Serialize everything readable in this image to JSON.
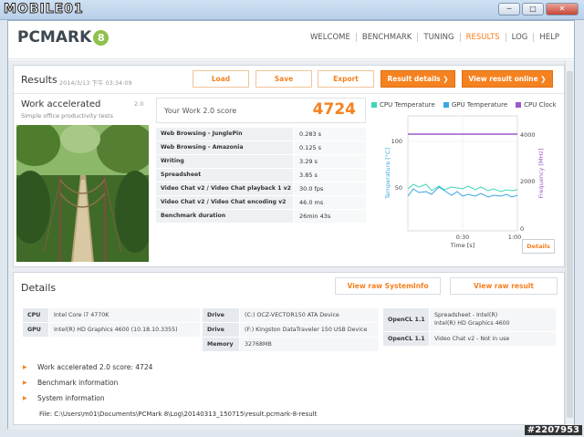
{
  "window": {
    "watermark": "MOBILE01",
    "minimize": "─",
    "maximize": "□",
    "close": "✕"
  },
  "header": {
    "logo_text": "PCMARK",
    "logo_badge": "8",
    "nav": [
      {
        "label": "WELCOME",
        "active": false
      },
      {
        "label": "BENCHMARK",
        "active": false
      },
      {
        "label": "TUNING",
        "active": false
      },
      {
        "label": "RESULTS",
        "active": true
      },
      {
        "label": "LOG",
        "active": false
      },
      {
        "label": "HELP",
        "active": false
      }
    ]
  },
  "results": {
    "title": "Results",
    "date": "2014/3/13 下午 03:34:09",
    "load_label": "Load",
    "save_label": "Save",
    "export_label": "Export",
    "result_details_label": "Result details ❯",
    "view_online_label": "View result online ❯",
    "test_name": "Work accelerated",
    "test_version": "2.0",
    "test_subtitle": "Simple office productivity tests",
    "score_label": "Your Work 2.0 score",
    "score_value": "4724",
    "rows": [
      {
        "k": "Web Browsing - JunglePin",
        "v": "0.283 s"
      },
      {
        "k": "Web Browsing - Amazonia",
        "v": "0.125 s"
      },
      {
        "k": "Writing",
        "v": "3.29 s"
      },
      {
        "k": "Spreadsheet",
        "v": "3.85 s"
      },
      {
        "k": "Video Chat v2 / Video Chat playback 1 v2",
        "v": "30.0 fps"
      },
      {
        "k": "Video Chat v2 / Video Chat encoding v2",
        "v": "46.0 ms"
      },
      {
        "k": "Benchmark duration",
        "v": "26min 43s"
      }
    ]
  },
  "graph": {
    "legend": [
      {
        "label": "CPU Temperature",
        "color": "#3fd6b8"
      },
      {
        "label": "GPU Temperature",
        "color": "#3aa6e0"
      },
      {
        "label": "CPU Clock",
        "color": "#9b59c8"
      }
    ],
    "y_left_label": "Temperature [°C]",
    "y_right_label": "Frequency [MHz]",
    "x_label": "Time [s]",
    "y_left_ticks": [
      "100",
      "50"
    ],
    "y_right_ticks": [
      "4000",
      "2000",
      "0"
    ],
    "x_ticks": [
      "0:30",
      "1:00"
    ],
    "details_label": "Details",
    "cpu_temp": [
      [
        0,
        48
      ],
      [
        3,
        53
      ],
      [
        6,
        50
      ],
      [
        10,
        53
      ],
      [
        13,
        46
      ],
      [
        17,
        51
      ],
      [
        20,
        47
      ],
      [
        24,
        50
      ],
      [
        27,
        49
      ],
      [
        30,
        48
      ],
      [
        33,
        51
      ],
      [
        37,
        47
      ],
      [
        40,
        50
      ],
      [
        44,
        46
      ],
      [
        47,
        48
      ],
      [
        51,
        45
      ],
      [
        54,
        47
      ],
      [
        57,
        46
      ],
      [
        60,
        47
      ]
    ],
    "gpu_temp": [
      [
        0,
        40
      ],
      [
        3,
        48
      ],
      [
        6,
        44
      ],
      [
        10,
        45
      ],
      [
        13,
        42
      ],
      [
        17,
        50
      ],
      [
        20,
        46
      ],
      [
        24,
        41
      ],
      [
        27,
        45
      ],
      [
        30,
        40
      ],
      [
        33,
        42
      ],
      [
        37,
        40
      ],
      [
        40,
        43
      ],
      [
        44,
        39
      ],
      [
        47,
        41
      ],
      [
        51,
        40
      ],
      [
        54,
        42
      ],
      [
        57,
        39
      ],
      [
        60,
        41
      ]
    ],
    "cpu_clock_mhz": 4000
  },
  "details": {
    "title": "Details",
    "view_sysinfo_label": "View raw SystemInfo",
    "view_result_label": "View raw result",
    "cpu_k": "CPU",
    "cpu_v": "Intel Core i7 4770K",
    "gpu_k": "GPU",
    "gpu_v": "Intel(R) HD Graphics 4600 (10.18.10.3355)",
    "drive1_k": "Drive",
    "drive1_v": "(C:) OCZ-VECTOR150 ATA Device",
    "drive2_k": "Drive",
    "drive2_v": "(F:) Kingston DataTraveler 150 USB Device",
    "memory_k": "Memory",
    "memory_v": "32768MB",
    "opencl1_k": "OpenCL 1.1",
    "opencl1_v1": "Spreadsheet - Intel(R)",
    "opencl1_v2": "Intel(R) HD Graphics 4600",
    "opencl2_k": "OpenCL 1.1",
    "opencl2_v": "Video Chat v2 - Not in use",
    "expanders": [
      "Work accelerated 2.0 score: 4724",
      "Benchmark information",
      "System information"
    ],
    "file_line": "File: C:\\Users\\m01\\Documents\\PCMark 8\\Log\\20140313_150715\\result.pcmark-8-result"
  },
  "corner_tag": "#2207953"
}
